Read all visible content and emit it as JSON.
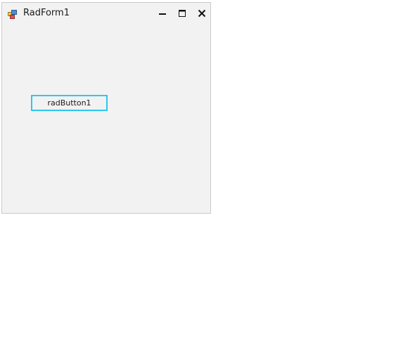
{
  "window": {
    "title": "RadForm1",
    "icon": "form-app-icon",
    "controls": {
      "minimize": "minimize-icon",
      "maximize": "maximize-icon",
      "close": "close-icon"
    }
  },
  "content": {
    "button_label": "radButton1",
    "button_focus_color": "#2cc7ee"
  }
}
